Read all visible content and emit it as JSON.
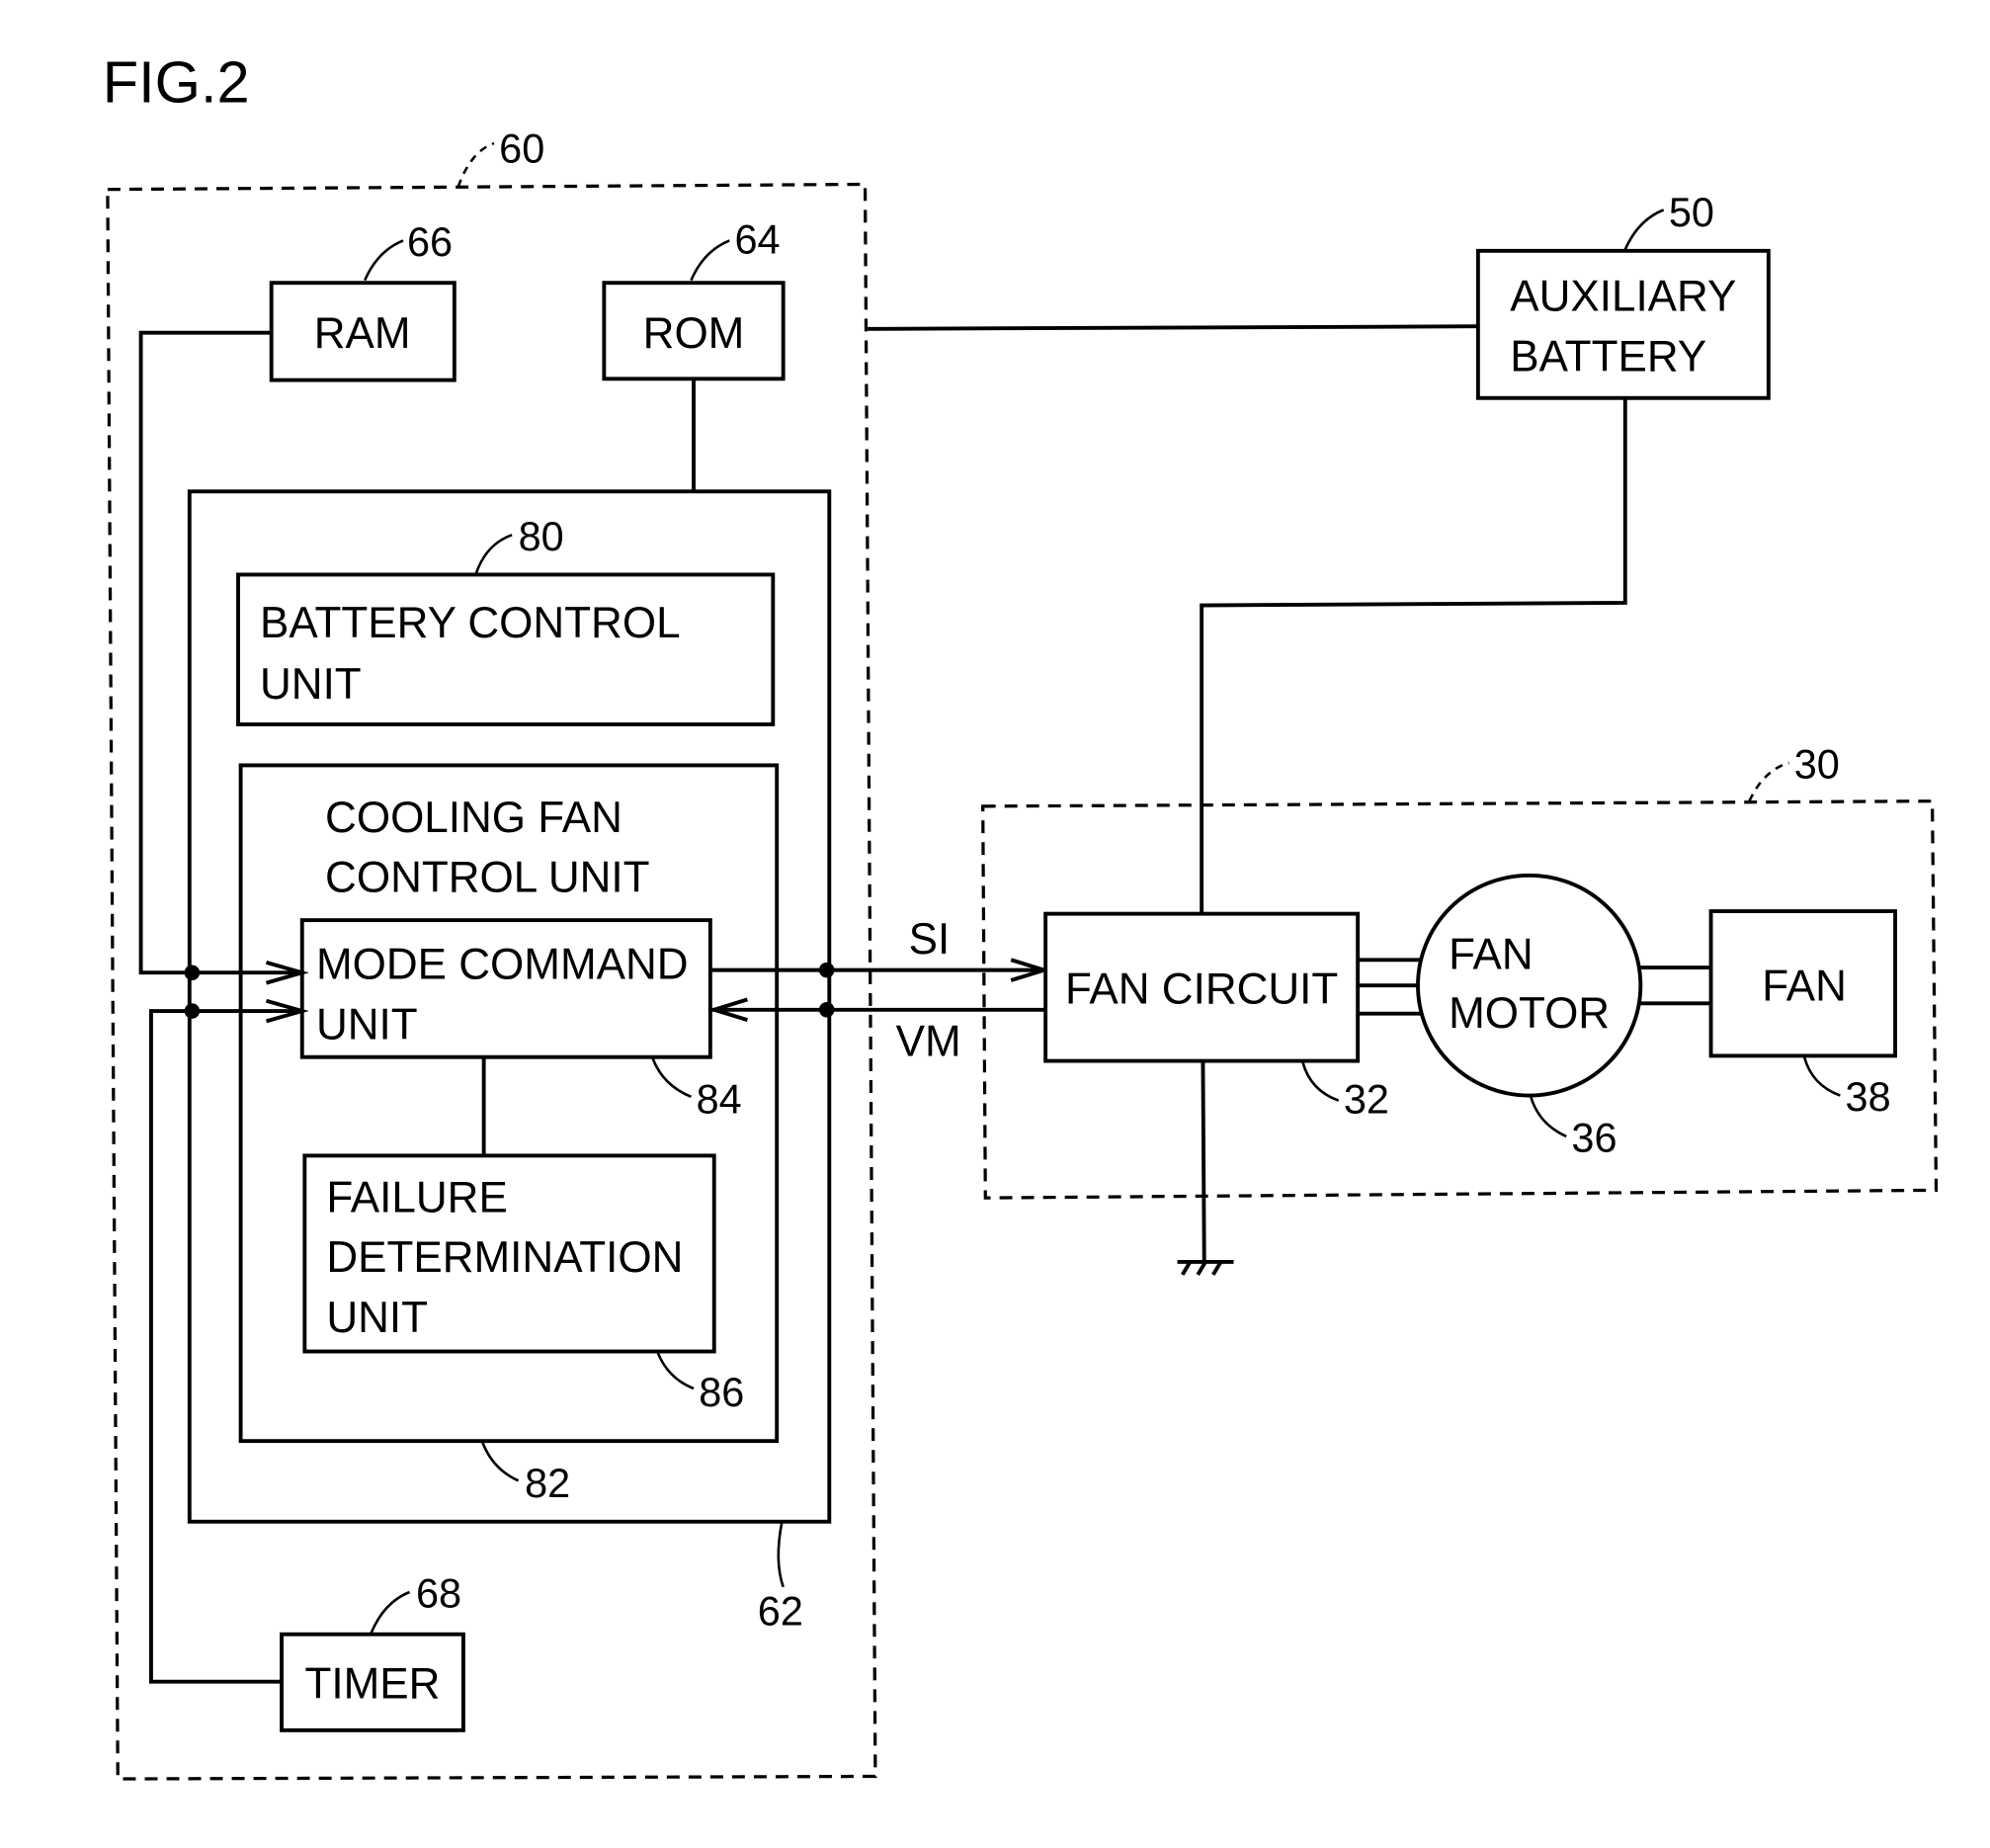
{
  "figure": {
    "title": "FIG.2"
  },
  "blocks": {
    "controller": {
      "ref": "60"
    },
    "cpu": {
      "ref": "62"
    },
    "rom": {
      "label": "ROM",
      "ref": "64"
    },
    "ram": {
      "label": "RAM",
      "ref": "66"
    },
    "timer": {
      "label": "TIMER",
      "ref": "68"
    },
    "battery_control": {
      "line1": "BATTERY CONTROL",
      "line2": "UNIT",
      "ref": "80"
    },
    "cooling_fan_control": {
      "line1": "COOLING FAN",
      "line2": "CONTROL UNIT",
      "ref": "82"
    },
    "mode_command": {
      "line1": "MODE COMMAND",
      "line2": "UNIT",
      "ref": "84"
    },
    "failure_determination": {
      "line1": "FAILURE",
      "line2": "DETERMINATION",
      "line3": "UNIT",
      "ref": "86"
    },
    "auxiliary_battery": {
      "line1": "AUXILIARY",
      "line2": "BATTERY",
      "ref": "50"
    },
    "fan_unit": {
      "ref": "30"
    },
    "fan_circuit": {
      "label": "FAN CIRCUIT",
      "ref": "32"
    },
    "fan_motor": {
      "line1": "FAN",
      "line2": "MOTOR",
      "ref": "36"
    },
    "fan": {
      "label": "FAN",
      "ref": "38"
    }
  },
  "signals": {
    "si": "SI",
    "vm": "VM"
  }
}
